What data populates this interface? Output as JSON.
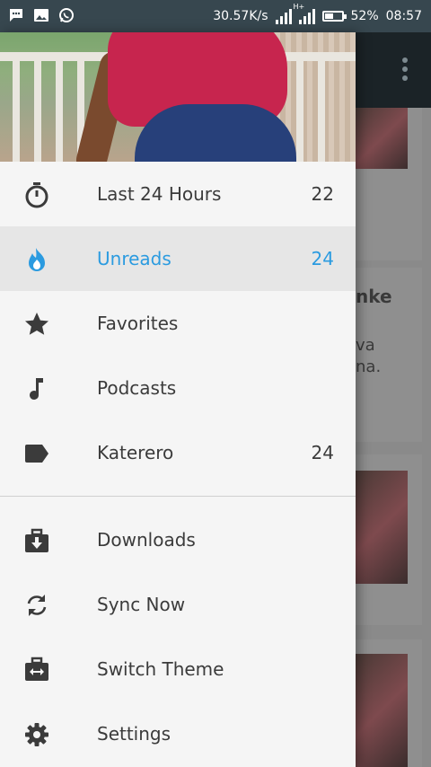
{
  "status_bar": {
    "left_icons": [
      "chat-bubble-icon",
      "image-icon",
      "whatsapp-icon"
    ],
    "network_speed": "30.57K/s",
    "network_type": "H+",
    "battery": "52%",
    "battery_level": 0.52,
    "time": "08:57"
  },
  "background_app": {
    "toolbar_icon": "overflow-menu-icon",
    "fragment_1": "nke",
    "fragment_2": "va",
    "fragment_3": "na."
  },
  "drawer": {
    "primary_items": [
      {
        "label": "Last 24 Hours",
        "count": "22",
        "icon": "timer-icon"
      },
      {
        "label": "Unreads",
        "count": "24",
        "icon": "flame-icon",
        "active": true
      },
      {
        "label": "Favorites",
        "count": "",
        "icon": "star-icon"
      },
      {
        "label": "Podcasts",
        "count": "",
        "icon": "music-note-icon"
      },
      {
        "label": "Katerero",
        "count": "24",
        "icon": "label-tag-icon"
      }
    ],
    "secondary_items": [
      {
        "label": "Downloads",
        "icon": "download-icon"
      },
      {
        "label": "Sync Now",
        "icon": "sync-icon"
      },
      {
        "label": "Switch Theme",
        "icon": "switch-theme-icon"
      },
      {
        "label": "Settings",
        "icon": "gear-icon"
      }
    ]
  },
  "colors": {
    "accent": "#2b9be0",
    "text": "#3b3b3b",
    "status_bar": "#37474f",
    "active_row": "#e6e6e6"
  }
}
